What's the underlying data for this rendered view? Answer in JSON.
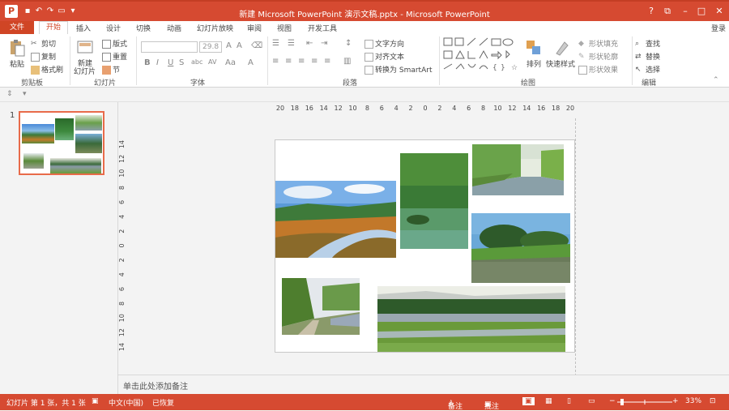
{
  "window": {
    "title": "新建 Microsoft PowerPoint 演示文稿.pptx -  Microsoft PowerPoint",
    "app_icon": "P",
    "controls": [
      "?",
      "⧉",
      "–",
      "□",
      "✕"
    ],
    "login": "登录"
  },
  "tabs": [
    "文件",
    "开始",
    "插入",
    "设计",
    "切换",
    "动画",
    "幻灯片放映",
    "审阅",
    "视图",
    "开发工具"
  ],
  "ribbon": {
    "clipboard": {
      "paste": "粘贴",
      "cut": "剪切",
      "copy": "复制",
      "format_painter": "格式刷",
      "label": "剪贴板"
    },
    "slides": {
      "new_slide_1": "新建",
      "new_slide_2": "幻灯片",
      "layout": "版式",
      "reset": "重置",
      "section": "节",
      "label": "幻灯片"
    },
    "font": {
      "font_name": "",
      "font_size": "29.8",
      "bold": "B",
      "italic": "I",
      "underline": "U",
      "strike": "S",
      "shadow": "abc",
      "spacing": "AV",
      "case": "Aa",
      "color": "A",
      "label": "字体"
    },
    "paragraph": {
      "text_direction": "文字方向",
      "align_text": "对齐文本",
      "smartart": "转换为 SmartArt",
      "label": "段落"
    },
    "drawing": {
      "arrange": "排列",
      "quick_styles": "快速样式",
      "shape_fill": "形状填充",
      "shape_outline": "形状轮廓",
      "shape_effects": "形状效果",
      "label": "绘图"
    },
    "editing": {
      "find": "查找",
      "replace": "替换",
      "select": "选择",
      "label": "编辑"
    }
  },
  "thumbnail": {
    "index": "1"
  },
  "ruler": {
    "h_ticks": [
      "20",
      "18",
      "16",
      "14",
      "12",
      "10",
      "8",
      "6",
      "4",
      "2",
      "0",
      "2",
      "4",
      "6",
      "8",
      "10",
      "12",
      "14",
      "16",
      "18",
      "20"
    ],
    "v_ticks": [
      "14",
      "12",
      "10",
      "8",
      "6",
      "4",
      "2",
      "0",
      "2",
      "4",
      "6",
      "8",
      "10",
      "12",
      "14"
    ]
  },
  "notes_placeholder": "单击此处添加备注",
  "status": {
    "slide_info": "幻灯片 第 1 张，共 1 张",
    "language": "中文(中国)",
    "recovered": "已恢复",
    "notes": "备注",
    "comments": "批注",
    "zoom": "33%"
  },
  "colors": {
    "accent": "#d64a31",
    "active_tab": "#d04525"
  }
}
